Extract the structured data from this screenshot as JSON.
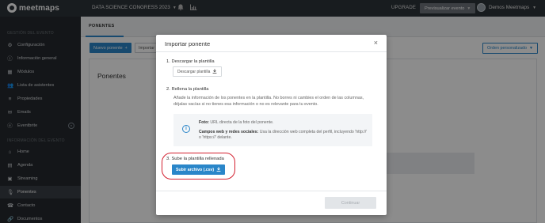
{
  "topbar": {
    "logo_text": "meetmaps",
    "event_name": "DATA SCIENCE CONGRESS 2023",
    "upgrade_label": "UPGRADE",
    "preview_label": "Previsualizar evento",
    "user_name": "Demos Meetmaps",
    "icons": [
      "bell-icon",
      "stats-icon",
      "chevron-down-icon"
    ]
  },
  "sidebar": {
    "section_management": "GESTIÓN DEL EVENTO",
    "management_items": [
      {
        "label": "Configuración",
        "icon": "gear-icon"
      },
      {
        "label": "Información general",
        "icon": "info-icon"
      },
      {
        "label": "Módulos",
        "icon": "grid-icon"
      },
      {
        "label": "Lista de asistentes",
        "icon": "users-icon"
      },
      {
        "label": "Propiedades",
        "icon": "sliders-icon"
      },
      {
        "label": "Emails",
        "icon": "mail-icon"
      },
      {
        "label": "Eventbrite",
        "icon": "eventbrite-icon"
      }
    ],
    "section_info": "INFORMACIÓN DEL EVENTO",
    "info_items": [
      {
        "label": "Home",
        "icon": "home-icon"
      },
      {
        "label": "Agenda",
        "icon": "calendar-icon"
      },
      {
        "label": "Streaming",
        "icon": "streaming-icon"
      },
      {
        "label": "Ponentes",
        "icon": "microphone-icon",
        "active": true
      },
      {
        "label": "Contacto",
        "icon": "phone-icon"
      },
      {
        "label": "Documentos",
        "icon": "document-icon"
      }
    ]
  },
  "main": {
    "tab_label": "PONENTES",
    "new_button": "Nuevo ponente",
    "import_button": "Importar p",
    "order_button": "Orden personalizado",
    "card_title": "Ponentes"
  },
  "modal": {
    "title": "Importar ponente",
    "close_symbol": "×",
    "step1_title": "1. Descargar la plantilla",
    "download_label": "Descargar plantilla",
    "step2_title": "2. Rellena la plantilla",
    "step2_desc": "Añade la información de los ponentes en la plantilla. No borres ni cambies el orden de las columnas, déjalas vacías si no tienes esa información o no es relevante para tu evento.",
    "info_photo_label": "Foto:",
    "info_photo_text": "URL directa de la foto del ponente.",
    "info_web_label": "Campos web y redes sociales:",
    "info_web_text": "Usa la dirección web completa del perfil, incluyendo 'http://' o 'https://' delante.",
    "step3_title": "3. Sube la plantilla rellenada",
    "upload_label": "Subir archivo (.csv)",
    "continue_label": "Continuar",
    "highlight_color": "#d3202f",
    "accent_color": "#2a86c9"
  }
}
